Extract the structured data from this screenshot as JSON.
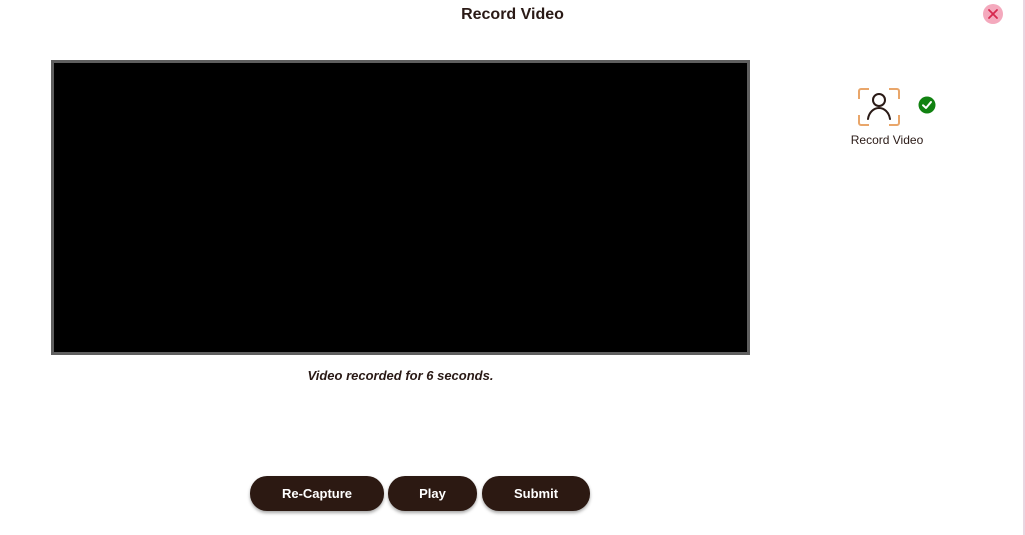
{
  "dialog": {
    "title": "Record Video",
    "close_icon": "close-icon"
  },
  "video": {
    "status_message": "Video recorded for 6 seconds."
  },
  "buttons": {
    "recapture_label": "Re-Capture",
    "play_label": "Play",
    "submit_label": "Submit"
  },
  "steps": [
    {
      "label": "Record Video",
      "icon": "user-frame-icon",
      "status": "complete",
      "status_icon": "check-circle-icon"
    }
  ],
  "colors": {
    "button_bg": "#2c1912",
    "button_text": "#ffffff",
    "title_text": "#2a1a16",
    "close_bg": "#f4a9bd",
    "close_x": "#d6294f",
    "icon_frame_accent": "#e9a66a",
    "check_green": "#118211",
    "video_border": "#5f5f5f",
    "video_bg": "#000000"
  }
}
